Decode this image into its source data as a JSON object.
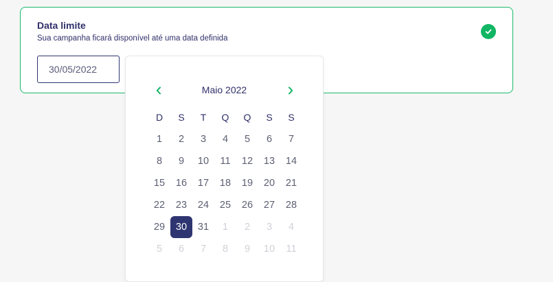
{
  "card": {
    "title": "Data limite",
    "description": "Sua campanha ficará disponível até uma data definida",
    "status_icon": "check-circle-icon",
    "accent_color": "#12b563"
  },
  "date_input": {
    "value": "30/05/2022"
  },
  "calendar": {
    "month_label": "Maio 2022",
    "prev_icon": "chevron-left-icon",
    "next_icon": "chevron-right-icon",
    "weekdays": [
      "D",
      "S",
      "T",
      "Q",
      "Q",
      "S",
      "S"
    ],
    "selected_day": "30",
    "selected_color": "#2e3570",
    "weeks": [
      [
        {
          "d": "1"
        },
        {
          "d": "2"
        },
        {
          "d": "3"
        },
        {
          "d": "4"
        },
        {
          "d": "5"
        },
        {
          "d": "6"
        },
        {
          "d": "7"
        }
      ],
      [
        {
          "d": "8"
        },
        {
          "d": "9"
        },
        {
          "d": "10"
        },
        {
          "d": "11"
        },
        {
          "d": "12"
        },
        {
          "d": "13"
        },
        {
          "d": "14"
        }
      ],
      [
        {
          "d": "15"
        },
        {
          "d": "16"
        },
        {
          "d": "17"
        },
        {
          "d": "18"
        },
        {
          "d": "19"
        },
        {
          "d": "20"
        },
        {
          "d": "21"
        }
      ],
      [
        {
          "d": "22"
        },
        {
          "d": "23"
        },
        {
          "d": "24"
        },
        {
          "d": "25"
        },
        {
          "d": "26"
        },
        {
          "d": "27"
        },
        {
          "d": "28"
        }
      ],
      [
        {
          "d": "29"
        },
        {
          "d": "30",
          "selected": true
        },
        {
          "d": "31"
        },
        {
          "d": "1",
          "muted": true
        },
        {
          "d": "2",
          "muted": true
        },
        {
          "d": "3",
          "muted": true
        },
        {
          "d": "4",
          "muted": true
        }
      ],
      [
        {
          "d": "5",
          "muted": true
        },
        {
          "d": "6",
          "muted": true
        },
        {
          "d": "7",
          "muted": true
        },
        {
          "d": "8",
          "muted": true
        },
        {
          "d": "9",
          "muted": true
        },
        {
          "d": "10",
          "muted": true
        },
        {
          "d": "11",
          "muted": true
        }
      ]
    ]
  }
}
